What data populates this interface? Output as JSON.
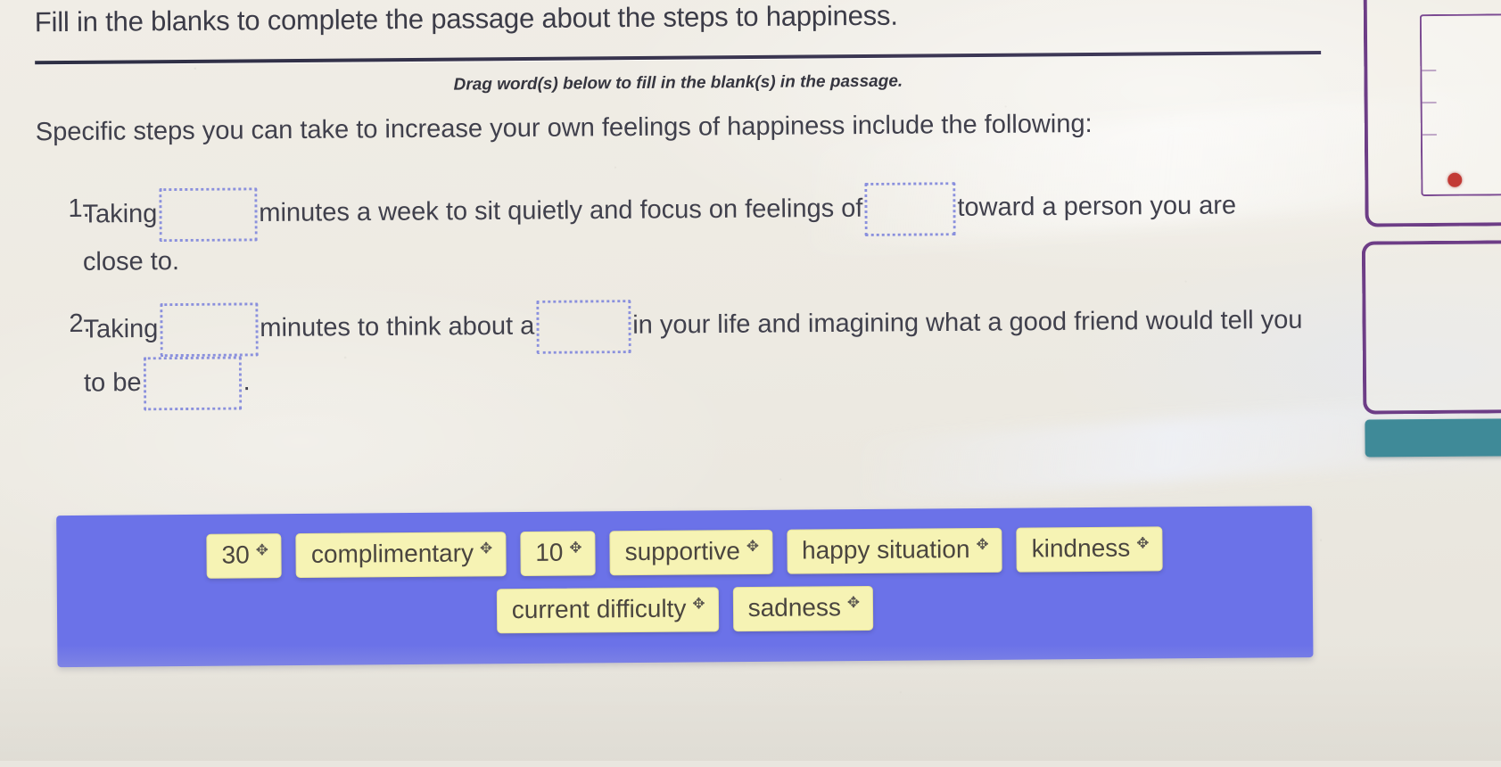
{
  "header": {
    "title": "Fill in the blanks to complete the passage about the steps to happiness.",
    "instruction": "Drag word(s) below to fill in the blank(s) in the passage."
  },
  "passage": {
    "intro": "Specific steps you can take to increase your own feelings of happiness include the following:",
    "items": [
      {
        "number": "1.",
        "seg1": "Taking",
        "seg2": "minutes a week to sit quietly and focus on feelings of",
        "seg3": "toward a person you are close to.",
        "blank1_value": "",
        "blank2_value": ""
      },
      {
        "number": "2.",
        "seg1": "Taking",
        "seg2": "minutes to think about a",
        "seg3": "in your life and imagining what a good friend would tell you to be",
        "seg4": ".",
        "blank1_value": "",
        "blank2_value": "",
        "blank3_value": ""
      }
    ]
  },
  "wordbank": {
    "background_color": "#6b72e8",
    "tile_color": "#f6f3b4",
    "drag_icon": "✥",
    "drag_icon_name": "move-handle-icon",
    "rows": [
      [
        {
          "label": "30"
        },
        {
          "label": "complimentary"
        },
        {
          "label": "10"
        },
        {
          "label": "supportive"
        },
        {
          "label": "happy situation"
        },
        {
          "label": "kindness"
        }
      ],
      [
        {
          "label": "current difficulty"
        },
        {
          "label": "sadness"
        }
      ]
    ]
  },
  "side_panels": {
    "accent_color": "#6d3d86",
    "button_color": "#3f8a98",
    "marker_color": "#c23a35"
  },
  "blank_border_color": "#8a90dd"
}
